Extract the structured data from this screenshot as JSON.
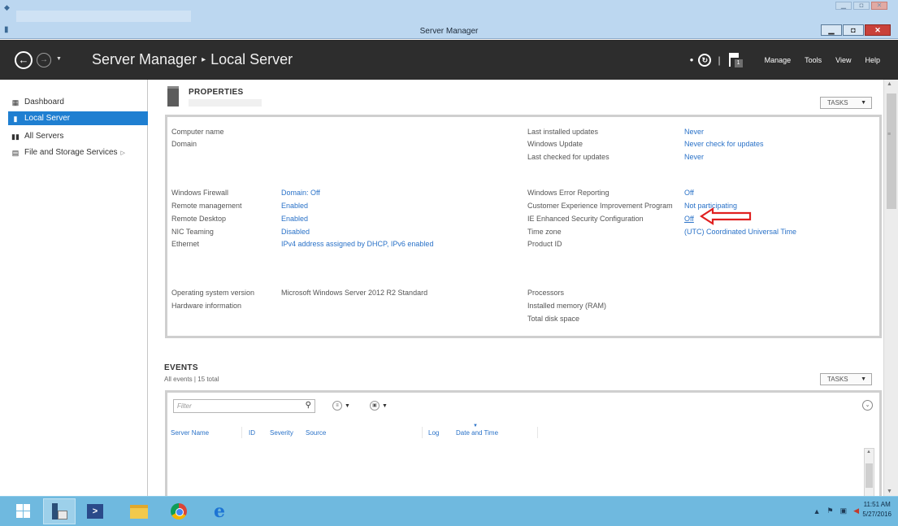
{
  "window": {
    "title": "Server Manager",
    "controls": {
      "minimize": "▁",
      "maximize": "◘",
      "close": "✕"
    }
  },
  "header": {
    "breadcrumb_root": "Server Manager",
    "breadcrumb_separator": "▸",
    "breadcrumb_current": "Local Server",
    "notification_count": "1",
    "menu": [
      "Manage",
      "Tools",
      "View",
      "Help"
    ]
  },
  "sidebar": {
    "items": [
      {
        "label": "Dashboard",
        "icon": "dashboard-icon",
        "active": false
      },
      {
        "label": "Local Server",
        "icon": "server-icon",
        "active": true
      },
      {
        "label": "All Servers",
        "icon": "servers-icon",
        "active": false
      },
      {
        "label": "File and Storage Services",
        "icon": "storage-icon",
        "active": false,
        "has_submenu": true
      }
    ]
  },
  "properties": {
    "title": "PROPERTIES",
    "tasks_label": "TASKS",
    "left_rows": [
      {
        "label": "Computer name",
        "value": ""
      },
      {
        "label": "Domain",
        "value": ""
      },
      {
        "label": "Windows Firewall",
        "value": "Domain: Off"
      },
      {
        "label": "Remote management",
        "value": "Enabled"
      },
      {
        "label": "Remote Desktop",
        "value": "Enabled"
      },
      {
        "label": "NIC Teaming",
        "value": "Disabled"
      },
      {
        "label": "Ethernet",
        "value": "IPv4 address assigned by DHCP, IPv6 enabled"
      },
      {
        "label": "Operating system version",
        "value": "Microsoft Windows Server 2012 R2 Standard"
      },
      {
        "label": "Hardware information",
        "value": ""
      }
    ],
    "right_rows": [
      {
        "label": "Last installed updates",
        "value": "Never"
      },
      {
        "label": "Windows Update",
        "value": "Never check for updates"
      },
      {
        "label": "Last checked for updates",
        "value": "Never"
      },
      {
        "label": "Windows Error Reporting",
        "value": "Off"
      },
      {
        "label": "Customer Experience Improvement Program",
        "value": "Not participating"
      },
      {
        "label": "IE Enhanced Security Configuration",
        "value": "Off"
      },
      {
        "label": "Time zone",
        "value": "(UTC) Coordinated Universal Time"
      },
      {
        "label": "Product ID",
        "value": ""
      },
      {
        "label": "Processors",
        "value": ""
      },
      {
        "label": "Installed memory (RAM)",
        "value": ""
      },
      {
        "label": "Total disk space",
        "value": ""
      }
    ]
  },
  "events": {
    "title": "EVENTS",
    "subtitle": "All events | 15 total",
    "tasks_label": "TASKS",
    "filter_placeholder": "Filter",
    "columns": [
      "Server Name",
      "ID",
      "Severity",
      "Source",
      "Log",
      "Date and Time"
    ]
  },
  "taskbar": {
    "apps": [
      "start",
      "server-manager",
      "powershell",
      "file-explorer",
      "chrome",
      "internet-explorer"
    ],
    "clock_time": "11:51 AM",
    "clock_date": "5/27/2016"
  },
  "colors": {
    "accent": "#1f7fd1",
    "link": "#2a72c8",
    "header_bg": "#2d2d2d",
    "taskbar_bg": "#6fb9df",
    "annotation_arrow": "#e02020"
  }
}
